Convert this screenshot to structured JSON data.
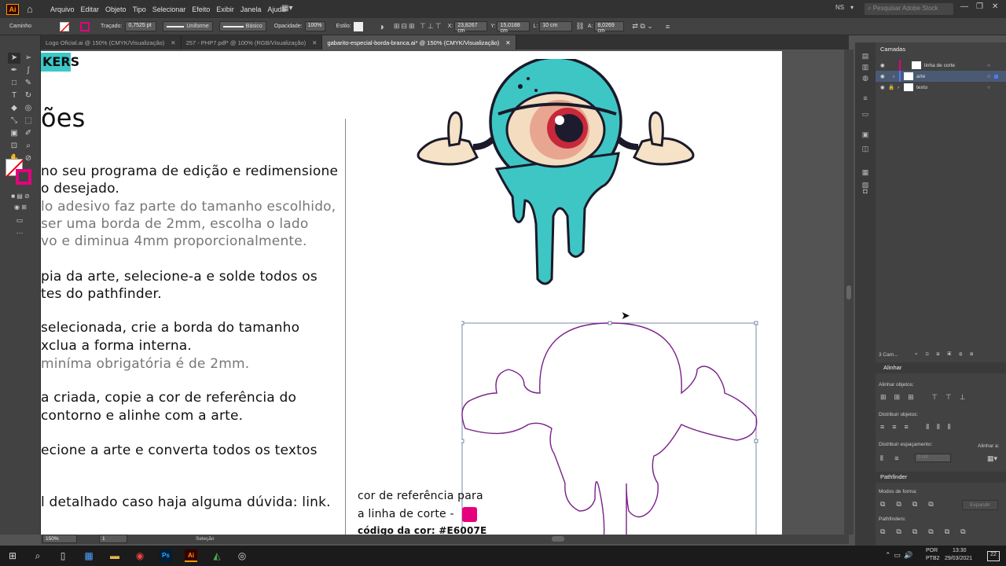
{
  "menubar": {
    "app_icon": "Ai",
    "items": [
      "Arquivo",
      "Editar",
      "Objeto",
      "Tipo",
      "Selecionar",
      "Efeito",
      "Exibir",
      "Janela",
      "Ajuda"
    ],
    "workspace": "NS",
    "search_placeholder": "Pesquisar Adobe Stock"
  },
  "controlbar": {
    "selection_label": "Caminho",
    "stroke_label": "Traçado:",
    "stroke_value": "0,7525 pt",
    "profile_value": "Uniforme",
    "brush_value": "Básico",
    "opacity_label": "Opacidade:",
    "opacity_value": "100%",
    "style_label": "Estilo:",
    "x_label": "X:",
    "x_value": "23,8267 cm",
    "y_label": "Y:",
    "y_value": "15,0188 cm",
    "w_label": "L:",
    "w_value": "10 cm",
    "h_label": "A:",
    "h_value": "8,0269 cm"
  },
  "tabs": [
    {
      "label": "Logo Oficial.ai @ 150% (CMYK/Visualização)",
      "active": false
    },
    {
      "label": "257 - PHP7.pdf* @ 100% (RGB/Visualização)",
      "active": false
    },
    {
      "label": "gabarito-especial-borda-branca.ai* @ 150% (CMYK/Visualização)",
      "active": true
    }
  ],
  "document": {
    "badge": "KERS",
    "heading": "ões",
    "lines": [
      {
        "text": "no seu programa de edição e redimensione",
        "gray": false
      },
      {
        "text": "o desejado.",
        "gray": false
      },
      {
        "text": "lo adesivo faz parte do tamanho escolhido,",
        "gray": true
      },
      {
        "text": "ser uma borda de 2mm, escolha o lado",
        "gray": true
      },
      {
        "text": "vo e diminua 4mm proporcionalmente.",
        "gray": true
      },
      {
        "text": "pia da arte, selecione-a e solde todos os",
        "gray": false
      },
      {
        "text": "tes do pathfinder.",
        "gray": false
      },
      {
        "text": "selecionada, crie a borda do tamanho",
        "gray": false
      },
      {
        "text": "xclua a forma interna.",
        "gray": false
      },
      {
        "text": "miníma obrigatória é de 2mm.",
        "gray": true
      },
      {
        "text": "a criada, copie a cor de referência do",
        "gray": false
      },
      {
        "text": "contorno e alinhe com a arte.",
        "gray": false
      },
      {
        "text": "ecione a arte e converta todos os textos",
        "gray": false
      },
      {
        "text": "l detalhado caso haja alguma dúvida: link.",
        "gray": false
      }
    ],
    "ref_line1": "cor de referência para",
    "ref_line2": "a linha de corte -",
    "ref_code": "código da cor: #E6007E",
    "ref_color": "#E6007E"
  },
  "status": {
    "zoom": "150%",
    "page": "1",
    "tool": "Seleção"
  },
  "layers_panel": {
    "title": "Camadas",
    "layers": [
      {
        "name": "linha de corte",
        "color": "#E6007E",
        "selected": false
      },
      {
        "name": "arte",
        "color": "#4a7bff",
        "selected": true
      },
      {
        "name": "texto",
        "color": "#cfcfcf",
        "selected": false
      }
    ],
    "count": "3 Cam..."
  },
  "align_panel": {
    "title": "Alinhar",
    "align_objects": "Alinhar objetos:",
    "distribute_objects": "Distribuir objetos:",
    "distribute_spacing": "Distribuir espaçamento:",
    "align_to": "Alinhar a:",
    "spacing_value": "0 cm"
  },
  "pathfinder_panel": {
    "title": "Pathfinder",
    "shape_modes": "Modos de forma:",
    "expand_label": "Expandir",
    "pathfinders": "Pathfinders:"
  },
  "taskbar": {
    "lang": "POR",
    "kb": "PTB2",
    "time": "13:30",
    "date": "29/03/2021",
    "notif": "22"
  },
  "colors": {
    "accent": "#E6007E",
    "badge": "#3cc8c8",
    "monster": "#3ec6c4",
    "outline": "#7a1f8a"
  }
}
